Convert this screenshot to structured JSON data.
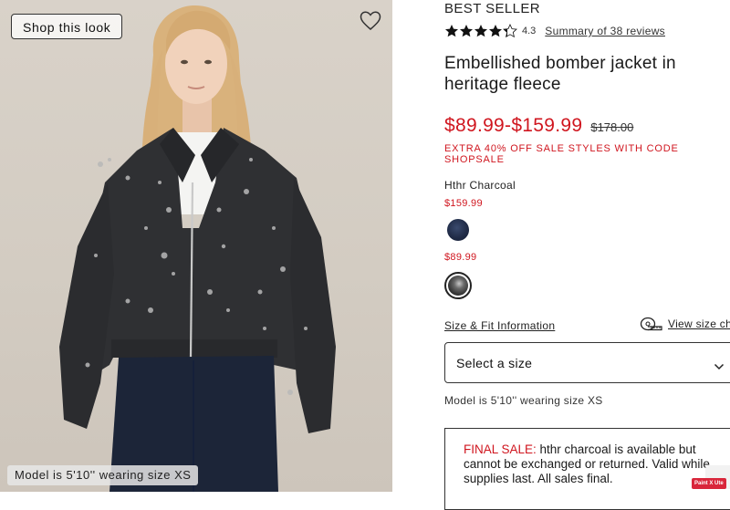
{
  "image": {
    "shop_button": "Shop this look",
    "model_caption": "Model is 5'10'' wearing size XS"
  },
  "product": {
    "badge": "BEST SELLER",
    "rating": 4.3,
    "rating_text": "4.3",
    "reviews_link": "Summary of 38 reviews",
    "title": "Embellished bomber jacket in heritage fleece",
    "price_range": "$89.99-$159.99",
    "original_price": "$178.00",
    "promo": "EXTRA 40% OFF SALE STYLES WITH CODE SHOPSALE",
    "selected_color": "Hthr Charcoal",
    "swatches": [
      {
        "price": "$159.99",
        "color": "#1f2a45"
      },
      {
        "price": "$89.99",
        "color": "#2e2e2e"
      }
    ],
    "size_fit_link": "Size & Fit Information",
    "size_chart_link": "View size chart",
    "size_select_label": "Select a size",
    "model_info": "Model is 5'10'' wearing size XS",
    "final_sale_label": "FINAL SALE:",
    "final_sale_text": " hthr charcoal is available but cannot be exchanged or returned. Valid while supplies last. All sales final."
  },
  "overlay": {
    "paint_badge": "Paint X Ute"
  },
  "colors": {
    "sale_red": "#d0161f",
    "text": "#1a1a1a",
    "photo_bg": "#d7d0c7"
  }
}
